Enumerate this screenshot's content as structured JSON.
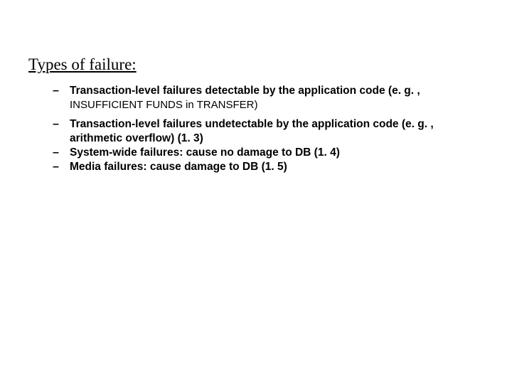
{
  "heading": "Types of failure:",
  "items": [
    {
      "main": "Transaction-level failures detectable by the application code (e. g. ,",
      "sub": "INSUFFICIENT FUNDS in TRANSFER)"
    },
    {
      "main": "Transaction-level failures undetectable by the application code (e. g. , arithmetic overflow)  (1. 3)"
    },
    {
      "main": "System-wide failures: cause no damage to DB  (1. 4)"
    },
    {
      "main": "Media failures: cause damage to DB (1. 5)"
    }
  ]
}
